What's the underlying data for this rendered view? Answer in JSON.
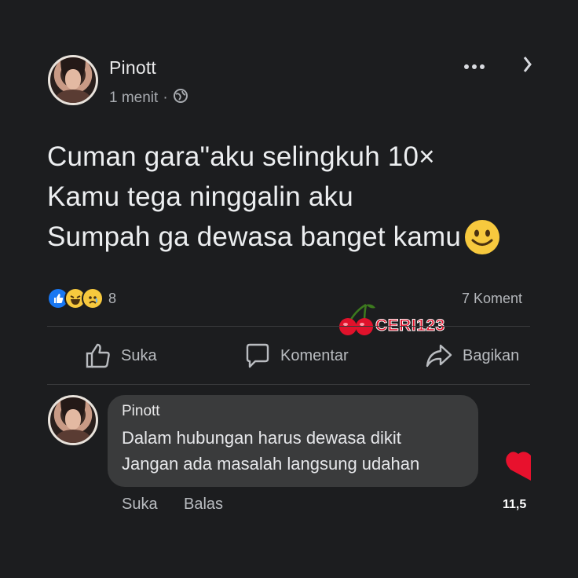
{
  "post": {
    "author": "Pinott",
    "time": "1 menit",
    "separator": "·",
    "privacy_icon": "globe-icon",
    "more_icon": "ellipsis-icon",
    "close_icon": "close-icon",
    "lines": [
      "Cuman gara\"aku selingkuh 10×",
      "Kamu tega ninggalin aku",
      "Sumpah ga dewasa banget kamu"
    ],
    "emoji_icon": "smiling-face-icon",
    "reactions": {
      "icons": [
        "like-icon",
        "haha-icon",
        "sad-icon"
      ],
      "count": "8"
    },
    "comments_count": "7 Koment"
  },
  "actions": {
    "like": "Suka",
    "comment": "Komentar",
    "share": "Bagikan"
  },
  "watermark": {
    "text": "CERI123",
    "icon": "cherry-icon",
    "color": "#e0122b"
  },
  "comment": {
    "author": "Pinott",
    "lines": [
      "Dalam hubungan harus dewasa dikit",
      "Jangan ada masalah langsung udahan"
    ],
    "like": "Suka",
    "reply": "Balas"
  },
  "side": {
    "heart_icon": "heart-icon",
    "count": "11,5",
    "heart_color": "#e8112d"
  },
  "colors": {
    "background": "#1c1d1f",
    "bubble": "#3a3b3c",
    "like_blue": "#1877f2",
    "emoji_yellow": "#f7c93e"
  }
}
